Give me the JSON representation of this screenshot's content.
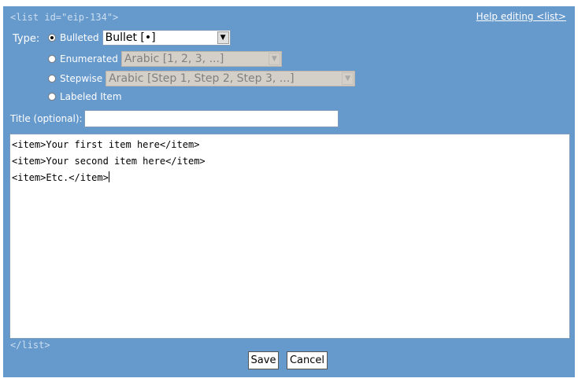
{
  "header": {
    "open_tag": "<list id=\"eip-134\">",
    "help_link": "Help editing <list>"
  },
  "type": {
    "label": "Type:",
    "options": [
      {
        "label": "Bulleted",
        "checked": true,
        "select_value": "Bullet [•]",
        "select_disabled": false
      },
      {
        "label": "Enumerated",
        "checked": false,
        "select_value": "Arabic [1, 2, 3, ...]",
        "select_disabled": true
      },
      {
        "label": "Stepwise",
        "checked": false,
        "select_value": "Arabic [Step 1, Step 2, Step 3, ...]",
        "select_disabled": true
      },
      {
        "label": "Labeled Item",
        "checked": false
      }
    ]
  },
  "title_field": {
    "label": "Title (optional):",
    "value": ""
  },
  "editor": {
    "lines": [
      "<item>Your first item here</item>",
      "<item>Your second item here</item>",
      "<item>Etc.</item>"
    ]
  },
  "footer": {
    "close_tag": "</list>",
    "save_label": "Save",
    "cancel_label": "Cancel"
  },
  "colors": {
    "panel_bg": "#6699cc",
    "tag_text": "#ccdff0"
  }
}
